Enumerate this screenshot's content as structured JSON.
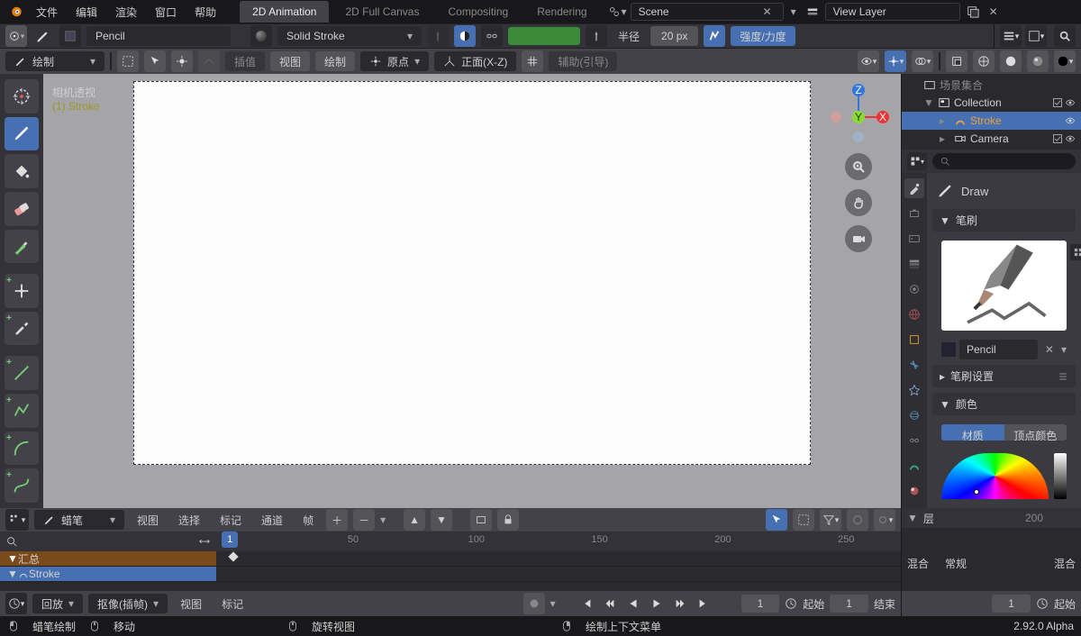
{
  "topmenu": {
    "items": [
      "文件",
      "编辑",
      "渲染",
      "窗口",
      "帮助"
    ]
  },
  "workspaces": {
    "tabs": [
      "2D Animation",
      "2D Full Canvas",
      "Compositing",
      "Rendering"
    ],
    "active": 0
  },
  "scene": {
    "label": "Scene"
  },
  "viewlayer": {
    "label": "View Layer"
  },
  "toolsettings": {
    "brush_name": "Pencil",
    "stroke_style": "Solid Stroke",
    "radius_label": "半径",
    "radius_value": "20 px",
    "strength_label": "强度/力度"
  },
  "header": {
    "mode": "绘制",
    "placeholder_interp": "插值",
    "btns": [
      "视图",
      "绘制"
    ],
    "origin": "原点",
    "orientation": "正面(X-Z)",
    "guides": "辅助(引导)"
  },
  "viewport_info": {
    "line1": "相机透视",
    "line2": "(1) Stroke"
  },
  "outliner": {
    "collection": "Collection",
    "items": [
      {
        "name": "Stroke",
        "icon": "gp",
        "sel": true
      },
      {
        "name": "Camera",
        "icon": "cam",
        "sel": false
      }
    ],
    "scene_collection": "场景集合"
  },
  "props": {
    "title": "Draw",
    "panel_brush": "笔刷",
    "brush_name": "Pencil",
    "panel_brush_settings": "笔刷设置",
    "panel_color": "颜色",
    "color_tabs": [
      "材质",
      "顶点颜色"
    ]
  },
  "timeline": {
    "mode": "蜡笔",
    "menu": [
      "视图",
      "选择",
      "标记",
      "通道",
      "帧"
    ],
    "ruler": [
      1,
      50,
      100,
      150,
      200,
      250
    ],
    "current": 1,
    "summary": "汇总",
    "tracks": [
      "Stroke"
    ],
    "layers_label": "层",
    "right_ruler": 200,
    "blend_label": "混合",
    "blend_mode": "常规",
    "right_blend": "混合"
  },
  "footer": {
    "playback": "回放",
    "sync": "抠像(插帧)",
    "view": "视图",
    "marker": "标记",
    "frame": 1,
    "start_label": "起始",
    "start": 1,
    "end_label": "结束",
    "r_frame": 1,
    "r_start_label": "起始"
  },
  "status": {
    "items": [
      "蜡笔绘制",
      "移动",
      "旋转视图",
      "绘制上下文菜单"
    ],
    "version": "2.92.0 Alpha"
  }
}
